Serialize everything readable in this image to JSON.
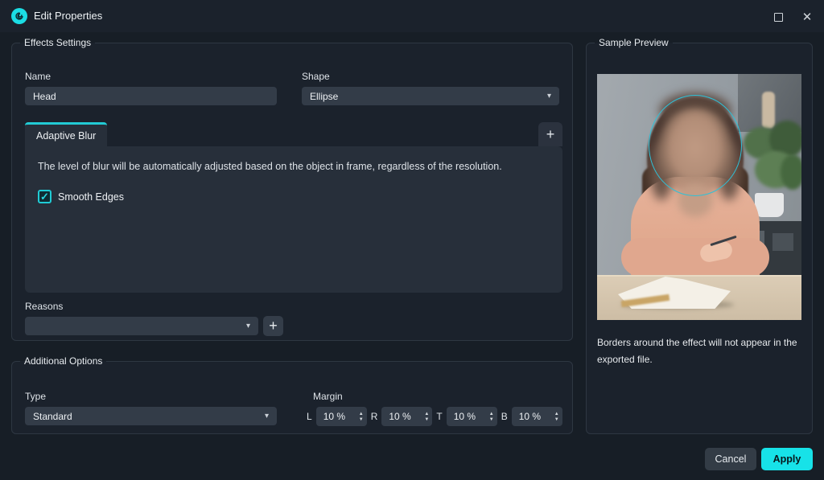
{
  "window": {
    "title": "Edit Properties"
  },
  "effects_settings": {
    "legend": "Effects Settings",
    "name_label": "Name",
    "name_value": "Head",
    "shape_label": "Shape",
    "shape_value": "Ellipse",
    "active_tab_label": "Adaptive Blur",
    "add_tab_label": "+",
    "blur_description": "The level of blur will be automatically adjusted based on the object in frame, regardless of the resolution.",
    "smooth_edges_label": "Smooth Edges",
    "smooth_edges_checked": true,
    "checkmark_glyph": "✓",
    "reasons_label": "Reasons",
    "reasons_value": "",
    "add_reason_label": "+"
  },
  "additional_options": {
    "legend": "Additional Options",
    "type_label": "Type",
    "type_value": "Standard",
    "margin_label": "Margin",
    "margins": [
      {
        "label": "L",
        "value": "10 %"
      },
      {
        "label": "R",
        "value": "10 %"
      },
      {
        "label": "T",
        "value": "10 %"
      },
      {
        "label": "B",
        "value": "10 %"
      }
    ]
  },
  "sample_preview": {
    "legend": "Sample Preview",
    "caption": "Borders around the effect will not appear in the exported file."
  },
  "footer": {
    "cancel_label": "Cancel",
    "apply_label": "Apply"
  },
  "icons": {
    "app_logo": "cyan-spiral",
    "maximize": "square-outline",
    "close": "✕",
    "dropdown_caret": "▾",
    "spin_up": "▲",
    "spin_down": "▼"
  },
  "colors": {
    "accent_cyan": "#17e2e8",
    "tab_indicator": "#22cbd4",
    "checkbox_border": "#20cbd4",
    "ellipse_outline": "#2ec1d8",
    "window_bg": "#171e26",
    "panel_bg": "#272f3a",
    "input_bg": "#333c48"
  }
}
